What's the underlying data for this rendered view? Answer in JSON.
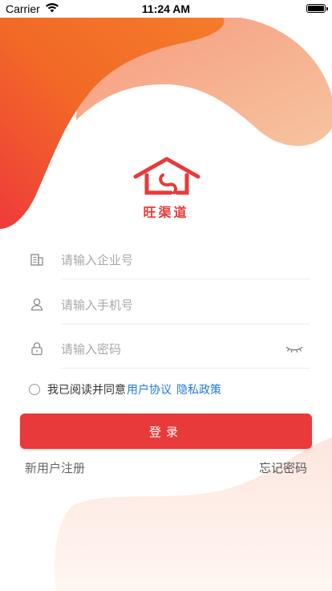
{
  "status_bar": {
    "carrier": "Carrier",
    "time": "11:24 AM"
  },
  "logo": {
    "text": "旺渠道"
  },
  "form": {
    "company_placeholder": "请输入企业号",
    "phone_placeholder": "请输入手机号",
    "password_placeholder": "请输入密码"
  },
  "agreement": {
    "prefix": "我已阅读并同意",
    "user_agreement": "用户协议",
    "privacy_policy": "隐私政策"
  },
  "login_button": "登录",
  "links": {
    "register": "新用户注册",
    "forgot_password": "忘记密码"
  },
  "colors": {
    "brand": "#e8393b",
    "link": "#1f7ad9",
    "gradient_start": "#f06a28",
    "gradient_end": "#f7b99a"
  }
}
